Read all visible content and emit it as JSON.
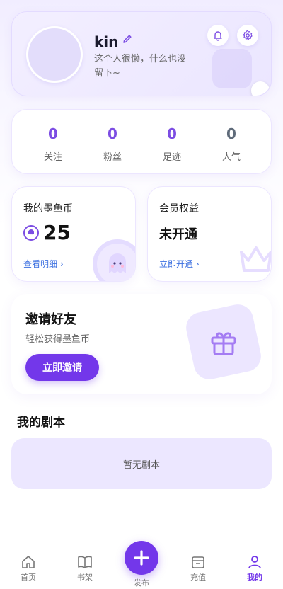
{
  "profile": {
    "username": "kin",
    "bio": "这个人很懒，什么也没留下~"
  },
  "stats": [
    {
      "value": "0",
      "label": "关注"
    },
    {
      "value": "0",
      "label": "粉丝"
    },
    {
      "value": "0",
      "label": "足迹"
    },
    {
      "value": "0",
      "label": "人气"
    }
  ],
  "coin": {
    "title": "我的墨鱼币",
    "value": "25",
    "link": "查看明细"
  },
  "vip": {
    "title": "会员权益",
    "status": "未开通",
    "link": "立即开通"
  },
  "invite": {
    "title": "邀请好友",
    "subtitle": "轻松获得墨鱼币",
    "button": "立即邀请"
  },
  "scripts": {
    "title": "我的剧本",
    "empty": "暂无剧本"
  },
  "tabbar": {
    "home": "首页",
    "shelf": "书架",
    "publish": "发布",
    "recharge": "充值",
    "mine": "我的"
  },
  "colors": {
    "accent": "#7337ea",
    "link": "#3b6fe0"
  }
}
